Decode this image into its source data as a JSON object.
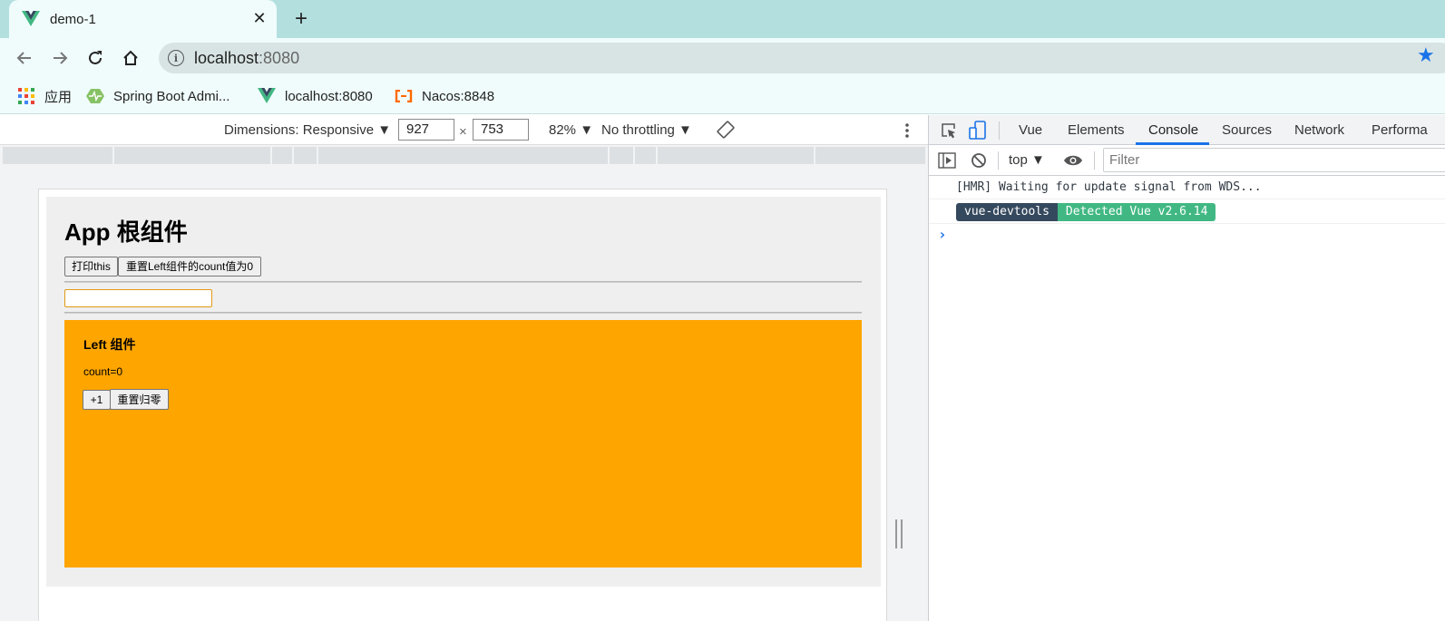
{
  "browser": {
    "tab": {
      "title": "demo-1"
    },
    "url": {
      "host": "localhost",
      "port": ":8080"
    },
    "bookmarks": [
      {
        "label": "应用",
        "icon": "apps-grid-icon"
      },
      {
        "label": "Spring Boot Admi...",
        "icon": "spring-boot-admin-icon"
      },
      {
        "label": "localhost:8080",
        "icon": "vue-logo-icon"
      },
      {
        "label": "Nacos:8848",
        "icon": "nacos-icon"
      }
    ]
  },
  "device_toolbar": {
    "dimensions_label": "Dimensions: Responsive ▼",
    "width": "927",
    "times": "×",
    "height": "753",
    "zoom": "82% ▼",
    "throttling": "No throttling ▼"
  },
  "app": {
    "title": "App 根组件",
    "print_button": "打印this",
    "reset_button": "重置Left组件的count值为0",
    "input_value": "",
    "left": {
      "title": "Left 组件",
      "count_text": "count=0",
      "plus_button": "+1",
      "reset_button": "重置归零"
    }
  },
  "devtools": {
    "tabs": [
      "Vue",
      "Elements",
      "Console",
      "Sources",
      "Network",
      "Performa"
    ],
    "active_tab": "Console",
    "context": "top ▼",
    "filter_placeholder": "Filter",
    "console": {
      "hmr_message": "[HMR] Waiting for update signal from WDS...",
      "badge_left": "vue-devtools",
      "badge_right": "Detected Vue v2.6.14",
      "prompt": "›"
    }
  },
  "colors": {
    "tabstrip": "#b3dfdf",
    "toolbar": "#f0fcfc",
    "left_component_bg": "#ffa500",
    "badge_dark": "#35495e",
    "badge_green": "#41b883",
    "devtools_accent": "#1a73e8"
  }
}
